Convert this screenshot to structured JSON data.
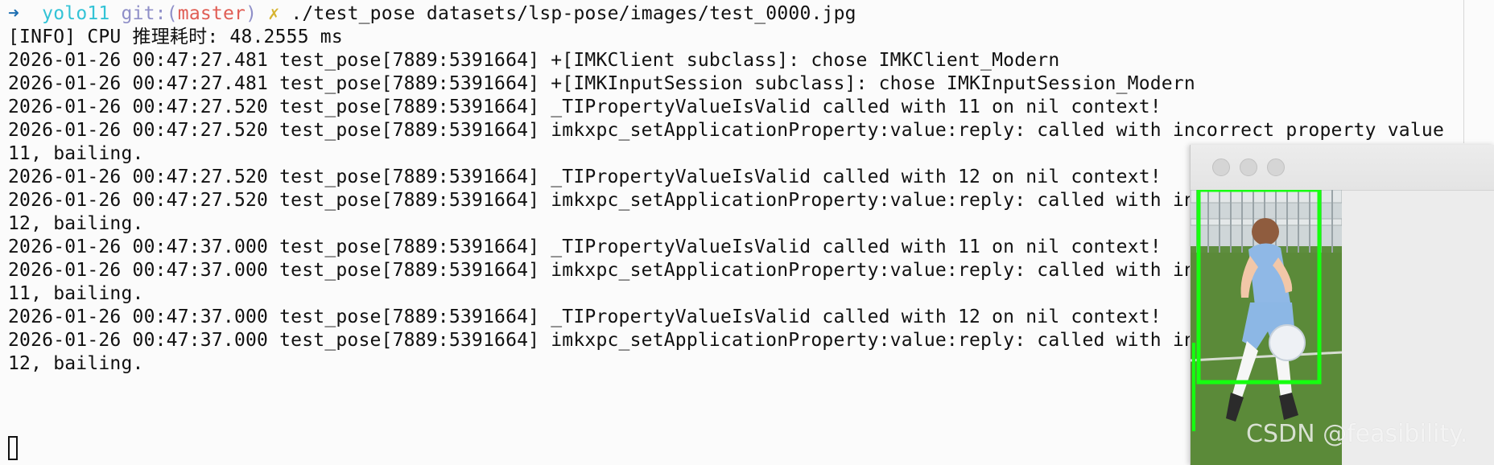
{
  "prompt": {
    "arrow": "➜",
    "directory": "yolo11",
    "git_label": "git:(",
    "branch": "master",
    "git_close": ")",
    "dirty_marker": "✗",
    "command": "./test_pose datasets/lsp-pose/images/test_0000.jpg"
  },
  "terminal_lines": [
    "[INFO] CPU 推理耗时: 48.2555 ms",
    "2026-01-26 00:47:27.481 test_pose[7889:5391664] +[IMKClient subclass]: chose IMKClient_Modern",
    "2026-01-26 00:47:27.481 test_pose[7889:5391664] +[IMKInputSession subclass]: chose IMKInputSession_Modern",
    "2026-01-26 00:47:27.520 test_pose[7889:5391664] _TIPropertyValueIsValid called with 11 on nil context!",
    "2026-01-26 00:47:27.520 test_pose[7889:5391664] imkxpc_setApplicationProperty:value:reply: called with incorrect property value",
    "11, bailing.",
    "2026-01-26 00:47:27.520 test_pose[7889:5391664] _TIPropertyValueIsValid called with 12 on nil context!",
    "2026-01-26 00:47:27.520 test_pose[7889:5391664] imkxpc_setApplicationProperty:value:reply: called with in",
    "12, bailing.",
    "2026-01-26 00:47:37.000 test_pose[7889:5391664] _TIPropertyValueIsValid called with 11 on nil context!",
    "2026-01-26 00:47:37.000 test_pose[7889:5391664] imkxpc_setApplicationProperty:value:reply: called with in",
    "11, bailing.",
    "2026-01-26 00:47:37.000 test_pose[7889:5391664] _TIPropertyValueIsValid called with 12 on nil context!",
    "2026-01-26 00:47:37.000 test_pose[7889:5391664] imkxpc_setApplicationProperty:value:reply: called with in",
    "12, bailing."
  ],
  "image_window": {
    "buttons": [
      "close-button",
      "minimize-button",
      "zoom-button"
    ],
    "detection_box_color": "#16ff10"
  },
  "watermark": "CSDN @feasibility."
}
